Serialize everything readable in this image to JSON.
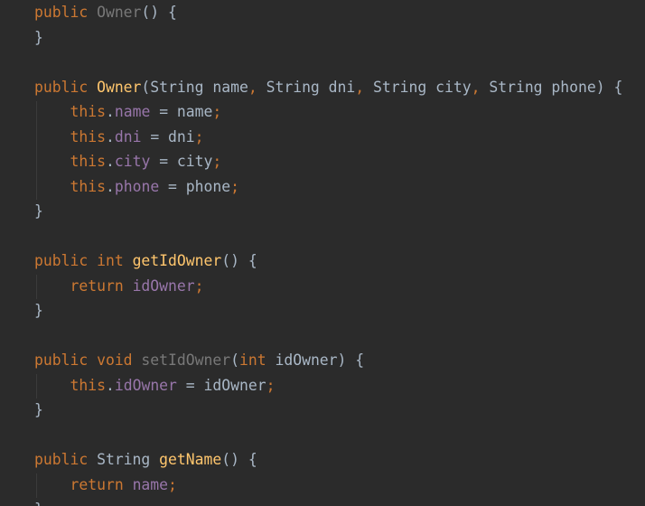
{
  "colors": {
    "background": "#2b2b2b",
    "keyword": "#cc7832",
    "method_declaration": "#ffc66d",
    "unused_symbol": "#787878",
    "field": "#9876aa",
    "default_text": "#a9b7c6"
  },
  "code_lines": [
    [
      {
        "t": "public ",
        "c": "kw"
      },
      {
        "t": "Owner",
        "c": "unused"
      },
      {
        "t": "() {",
        "c": "plain"
      }
    ],
    [
      {
        "t": "}",
        "c": "plain"
      }
    ],
    [],
    [
      {
        "t": "public ",
        "c": "kw"
      },
      {
        "t": "Owner",
        "c": "fn"
      },
      {
        "t": "(String name",
        "c": "plain"
      },
      {
        "t": ", ",
        "c": "punc"
      },
      {
        "t": "String dni",
        "c": "plain"
      },
      {
        "t": ", ",
        "c": "punc"
      },
      {
        "t": "String city",
        "c": "plain"
      },
      {
        "t": ", ",
        "c": "punc"
      },
      {
        "t": "String phone) {",
        "c": "plain"
      }
    ],
    [
      {
        "t": "    ",
        "c": "plain"
      },
      {
        "t": "this",
        "c": "kw"
      },
      {
        "t": ".",
        "c": "plain"
      },
      {
        "t": "name",
        "c": "field"
      },
      {
        "t": " = name",
        "c": "plain"
      },
      {
        "t": ";",
        "c": "punc"
      }
    ],
    [
      {
        "t": "    ",
        "c": "plain"
      },
      {
        "t": "this",
        "c": "kw"
      },
      {
        "t": ".",
        "c": "plain"
      },
      {
        "t": "dni",
        "c": "field"
      },
      {
        "t": " = dni",
        "c": "plain"
      },
      {
        "t": ";",
        "c": "punc"
      }
    ],
    [
      {
        "t": "    ",
        "c": "plain"
      },
      {
        "t": "this",
        "c": "kw"
      },
      {
        "t": ".",
        "c": "plain"
      },
      {
        "t": "city",
        "c": "field"
      },
      {
        "t": " = city",
        "c": "plain"
      },
      {
        "t": ";",
        "c": "punc"
      }
    ],
    [
      {
        "t": "    ",
        "c": "plain"
      },
      {
        "t": "this",
        "c": "kw"
      },
      {
        "t": ".",
        "c": "plain"
      },
      {
        "t": "phone",
        "c": "field"
      },
      {
        "t": " = phone",
        "c": "plain"
      },
      {
        "t": ";",
        "c": "punc"
      }
    ],
    [
      {
        "t": "}",
        "c": "plain"
      }
    ],
    [],
    [
      {
        "t": "public ",
        "c": "kw"
      },
      {
        "t": "int ",
        "c": "kw"
      },
      {
        "t": "getIdOwner",
        "c": "fn"
      },
      {
        "t": "() {",
        "c": "plain"
      }
    ],
    [
      {
        "t": "    ",
        "c": "plain"
      },
      {
        "t": "return ",
        "c": "kw"
      },
      {
        "t": "idOwner",
        "c": "field"
      },
      {
        "t": ";",
        "c": "punc"
      }
    ],
    [
      {
        "t": "}",
        "c": "plain"
      }
    ],
    [],
    [
      {
        "t": "public ",
        "c": "kw"
      },
      {
        "t": "void ",
        "c": "kw"
      },
      {
        "t": "setIdOwner",
        "c": "unused"
      },
      {
        "t": "(",
        "c": "plain"
      },
      {
        "t": "int ",
        "c": "kw"
      },
      {
        "t": "idOwner) {",
        "c": "plain"
      }
    ],
    [
      {
        "t": "    ",
        "c": "plain"
      },
      {
        "t": "this",
        "c": "kw"
      },
      {
        "t": ".",
        "c": "plain"
      },
      {
        "t": "idOwner",
        "c": "field"
      },
      {
        "t": " = idOwner",
        "c": "plain"
      },
      {
        "t": ";",
        "c": "punc"
      }
    ],
    [
      {
        "t": "}",
        "c": "plain"
      }
    ],
    [],
    [
      {
        "t": "public ",
        "c": "kw"
      },
      {
        "t": "String ",
        "c": "plain"
      },
      {
        "t": "getName",
        "c": "fn"
      },
      {
        "t": "() {",
        "c": "plain"
      }
    ],
    [
      {
        "t": "    ",
        "c": "plain"
      },
      {
        "t": "return ",
        "c": "kw"
      },
      {
        "t": "name",
        "c": "field"
      },
      {
        "t": ";",
        "c": "punc"
      }
    ],
    [
      {
        "t": "}",
        "c": "plain"
      }
    ]
  ]
}
